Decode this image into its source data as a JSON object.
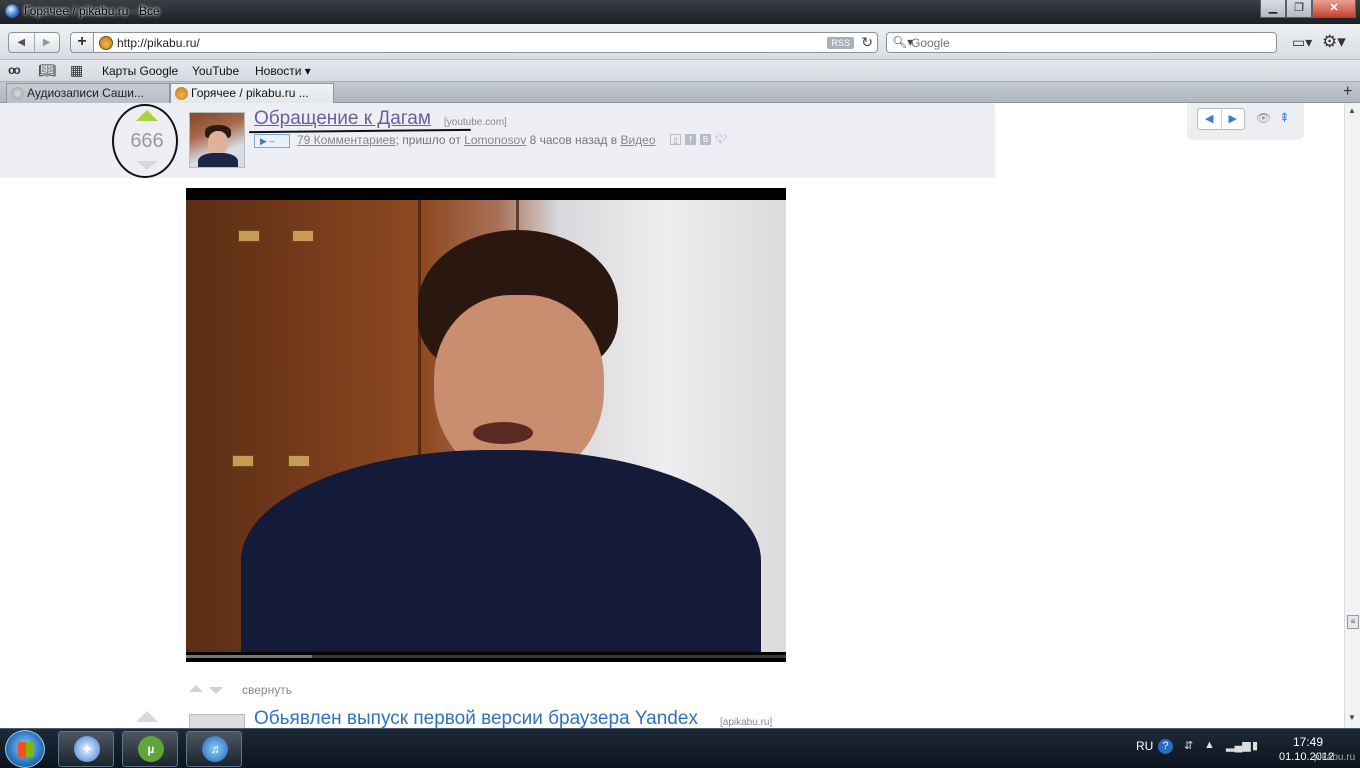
{
  "window": {
    "title": "Горячее / pikabu.ru - Все",
    "min_label": "▁",
    "max_label": "❐",
    "close_label": "✕"
  },
  "toolbar": {
    "back_icon": "◀",
    "forward_icon": "▶",
    "add_label": "+",
    "url": "http://pikabu.ru/",
    "rss_label": "RSS",
    "reload_icon": "↻",
    "search_placeholder": "Google",
    "search_icon": "🔍︎▾",
    "page_menu_icon": "▭▾",
    "gear_menu_icon": "⚙▾"
  },
  "bookmarks": {
    "reader_icon": "oo",
    "book_icon": "📖︎",
    "grid_icon": "▦",
    "items": [
      {
        "label": "Карты Google"
      },
      {
        "label": "YouTube"
      },
      {
        "label": "Новости ▾"
      }
    ]
  },
  "tabs": [
    {
      "label": "Аудиозаписи Саши...",
      "active": false
    },
    {
      "label": "Горячее / pikabu.ru ...",
      "active": true
    }
  ],
  "new_tab_label": "+",
  "story": {
    "rating": "666",
    "title": "Обращение к Дагам",
    "domain": "[youtube.com]",
    "play_label": "▶ –",
    "comments_link": "79 Комментариев",
    "meta_text_1": "; пришло от",
    "author": "Lomonosov",
    "meta_text_2": "8 часов назад в",
    "category": "Видео",
    "share_save": "▯",
    "share_fb": "f",
    "share_vk": "B",
    "share_tw": "🐦︎",
    "video_progress": 0.21
  },
  "navbox": {
    "prev_icon": "◀",
    "next_icon": "▶",
    "hide_icon": "👁︎",
    "top_icon": "⇞"
  },
  "collapse_label": "свернуть",
  "next_story": {
    "title": "Обьявлен выпуск первой версии браузера Yandex",
    "domain": "[apikabu.ru]"
  },
  "taskbar": {
    "lang": "RU",
    "help": "?",
    "time": "17:49",
    "date": "01.10.2012",
    "utorrent_label": "µ",
    "itunes_label": "♫",
    "safari_label": "✦"
  },
  "watermark": "pikabu.ru",
  "colors": {
    "vote_up": "#a7d33d",
    "story_title": "#6b5e9c",
    "link_blue": "#2f73c0"
  }
}
